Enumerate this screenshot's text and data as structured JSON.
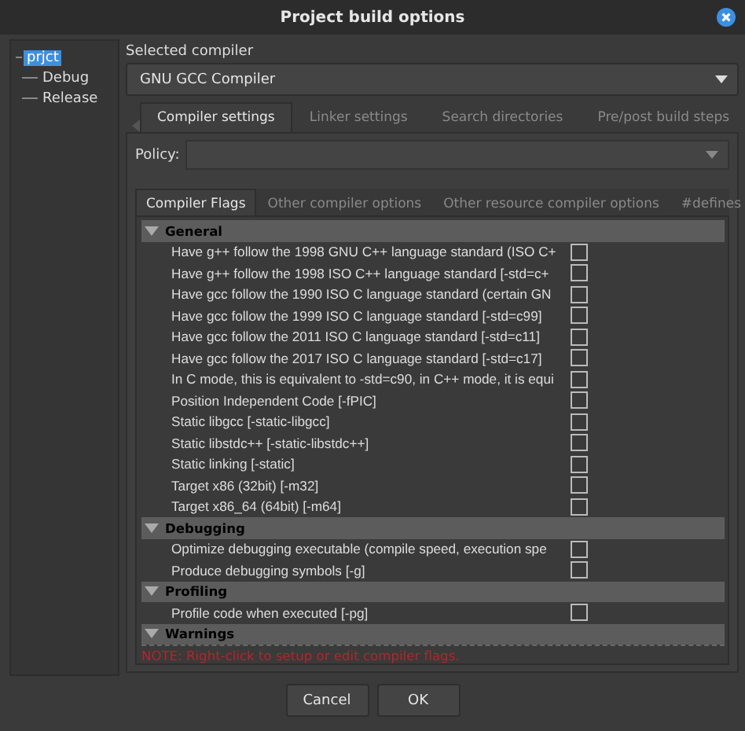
{
  "window": {
    "title": "Project build options"
  },
  "tree": {
    "label": "prjct",
    "selected": true,
    "children": [
      {
        "label": "Debug",
        "selected": false
      },
      {
        "label": "Release",
        "selected": false
      }
    ]
  },
  "compiler": {
    "label": "Selected compiler",
    "value": "GNU GCC Compiler"
  },
  "tabs": [
    {
      "label": "Compiler settings",
      "selected": true
    },
    {
      "label": "Linker settings",
      "selected": false
    },
    {
      "label": "Search directories",
      "selected": false
    },
    {
      "label": "Pre/post build steps",
      "selected": false
    }
  ],
  "policy": {
    "label": "Policy:"
  },
  "inner_tabs": [
    {
      "label": "Compiler Flags",
      "selected": true
    },
    {
      "label": "Other compiler options",
      "selected": false
    },
    {
      "label": "Other resource compiler options",
      "selected": false
    },
    {
      "label": "#defines",
      "selected": false
    }
  ],
  "flags": [
    {
      "kind": "category",
      "label": "General",
      "expanded": true
    },
    {
      "kind": "flag",
      "label": "Have g++ follow the 1998 GNU C++ language standard (ISO C+",
      "checked": false
    },
    {
      "kind": "flag",
      "label": "Have g++ follow the 1998 ISO C++ language standard  [-std=c+",
      "checked": false
    },
    {
      "kind": "flag",
      "label": "Have gcc follow the 1990 ISO C language standard  (certain GN",
      "checked": false
    },
    {
      "kind": "flag",
      "label": "Have gcc follow the 1999 ISO C language standard  [-std=c99]",
      "checked": false
    },
    {
      "kind": "flag",
      "label": "Have gcc follow the 2011 ISO C language standard  [-std=c11]",
      "checked": false
    },
    {
      "kind": "flag",
      "label": "Have gcc follow the 2017 ISO C language standard  [-std=c17]",
      "checked": false
    },
    {
      "kind": "flag",
      "label": "In C mode, this is equivalent to -std=c90, in C++ mode, it is equi",
      "checked": false
    },
    {
      "kind": "flag",
      "label": "Position Independent Code  [-fPIC]",
      "checked": false
    },
    {
      "kind": "flag",
      "label": "Static libgcc  [-static-libgcc]",
      "checked": false
    },
    {
      "kind": "flag",
      "label": "Static libstdc++  [-static-libstdc++]",
      "checked": false
    },
    {
      "kind": "flag",
      "label": "Static linking  [-static]",
      "checked": false
    },
    {
      "kind": "flag",
      "label": "Target x86 (32bit)  [-m32]",
      "checked": false
    },
    {
      "kind": "flag",
      "label": "Target x86_64 (64bit)  [-m64]",
      "checked": false
    },
    {
      "kind": "category",
      "label": "Debugging",
      "expanded": true
    },
    {
      "kind": "flag",
      "label": "Optimize debugging executable (compile speed, execution spe",
      "checked": false
    },
    {
      "kind": "flag",
      "label": "Produce debugging symbols  [-g]",
      "checked": false
    },
    {
      "kind": "category",
      "label": "Profiling",
      "expanded": true
    },
    {
      "kind": "flag",
      "label": "Profile code when executed  [-pg]",
      "checked": false
    },
    {
      "kind": "category",
      "label": "Warnings",
      "expanded": true
    }
  ],
  "note": "NOTE: Right-click to setup or edit compiler flags.",
  "buttons": [
    {
      "label": "Cancel"
    },
    {
      "label": "OK"
    }
  ]
}
